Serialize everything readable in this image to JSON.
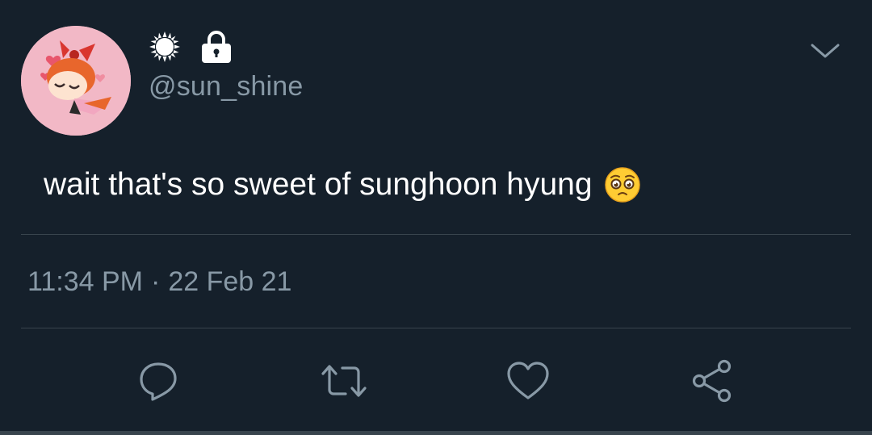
{
  "tweet": {
    "avatar_icon": "powerpuff-avatar",
    "name_icons": [
      "sun-icon",
      "lock-icon"
    ],
    "handle": "@sun_shine",
    "menu_icon": "chevron-down-icon",
    "text": "wait that's so sweet of sunghoon hyung",
    "emoji": "pleading-face-emoji",
    "time": "11:34 PM",
    "separator": "·",
    "date": "22 Feb 21"
  },
  "actions": [
    {
      "name": "reply",
      "icon": "reply-icon"
    },
    {
      "name": "retweet",
      "icon": "retweet-icon"
    },
    {
      "name": "like",
      "icon": "heart-icon"
    },
    {
      "name": "share",
      "icon": "share-icon"
    }
  ],
  "colors": {
    "background": "#15202b",
    "text": "#ffffff",
    "secondary_text": "#8899a6",
    "divider": "#38444d",
    "avatar_bg": "#f2b8c6"
  }
}
